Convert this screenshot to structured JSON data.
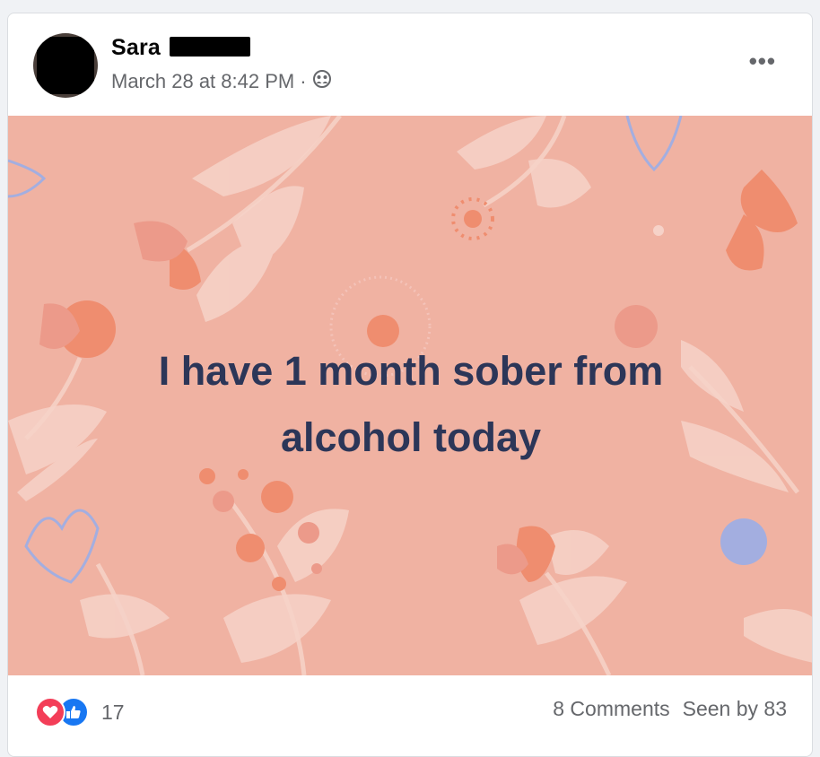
{
  "post": {
    "author": "Sara",
    "timestamp": "March 28 at 8:42 PM",
    "separator": "·",
    "audience_icon": "friends-icon",
    "more_label": "•••",
    "text_line1": "I have 1 month sober from",
    "text_line2": "alcohol today",
    "background_color": "#f0b2a2",
    "text_color": "#2c3658"
  },
  "footer": {
    "reaction_count": "17",
    "comments": "8 Comments",
    "seen_by": "Seen by 83"
  },
  "colors": {
    "love": "#f33e58",
    "like": "#1877f2",
    "secondary_text": "#65676b"
  }
}
